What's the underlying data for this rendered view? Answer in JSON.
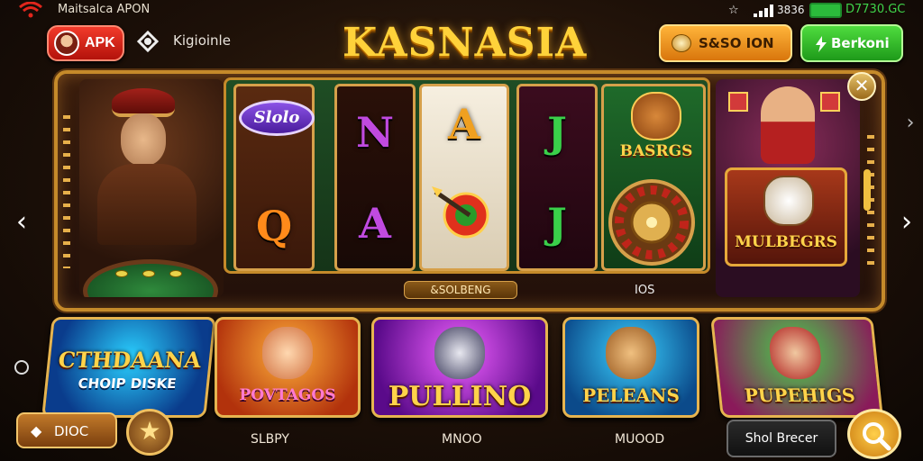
{
  "status_bar": {
    "app_name": "Maitsalca APON",
    "signal_text": "☆",
    "battery_pct": "3836",
    "time": "D7730.GC"
  },
  "header": {
    "apk_label": "APK",
    "brand_label": "Kigioinle",
    "title": "KASNASIA",
    "coin_button_label": "S&SO ION",
    "bonus_button_label": "Berkoni"
  },
  "featured": {
    "slot_badge": "Slolo",
    "reel_symbols": [
      [
        "Q"
      ],
      [
        "N",
        "A"
      ],
      [
        "A"
      ],
      [
        "J",
        "J"
      ]
    ],
    "reel5_label": "BASRGS",
    "reels_label": "&SOLBENG",
    "reels_sub": "IOS",
    "promo_label": "MULBEGRS",
    "close_icon": "✕",
    "nav_left": "‹",
    "nav_right": "›",
    "nav_right_top": "›"
  },
  "cards": [
    {
      "title": "CTHDAANA",
      "subtitle": "CHOIP DISKE"
    },
    {
      "title": "POVTAGOS"
    },
    {
      "title": "PULLINO"
    },
    {
      "title": "PELEANS"
    },
    {
      "title": "PUPEHIGS"
    }
  ],
  "bottom": {
    "back_icon": "◆",
    "back_label": "DIOC",
    "star_icon": "★",
    "labels": [
      "SLBPY",
      "MNOO",
      "MUOOD"
    ],
    "bet_button": "Shol Brecer"
  },
  "colors": {
    "accent_gold": "#ffd23a",
    "apk_red": "#d8201a",
    "bonus_green": "#2bbb3b",
    "coin_orange": "#f0a030"
  },
  "icons": [
    "wifi-icon",
    "signal-bars-icon",
    "battery-icon",
    "brand-logo-icon",
    "coin-icon",
    "bolt-icon",
    "close-icon",
    "chevron-left-icon",
    "chevron-right-icon",
    "star-icon",
    "search-icon",
    "roulette-icon"
  ]
}
